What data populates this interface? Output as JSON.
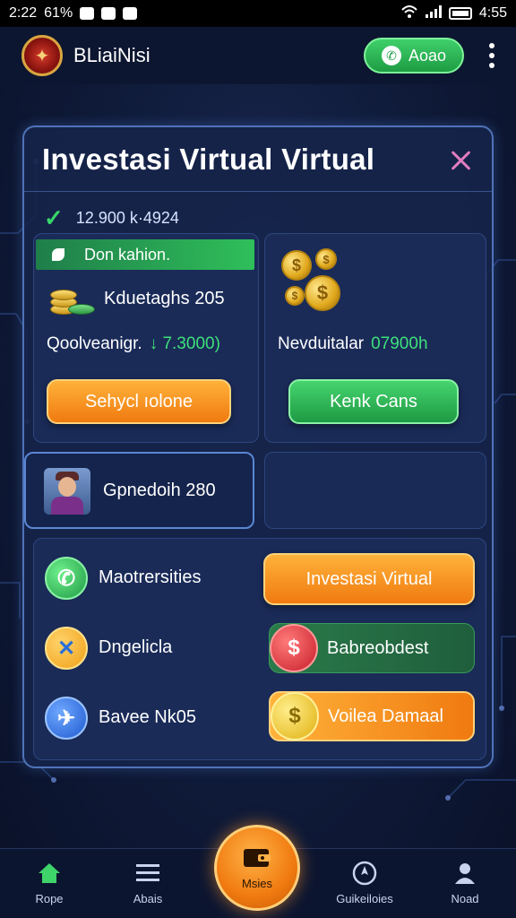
{
  "status_bar": {
    "time": "2:22",
    "percent": "61%",
    "right_time": "4:55"
  },
  "app_bar": {
    "title": "BLiaiNisi",
    "call_label": "Aoao"
  },
  "panel": {
    "title": "Investasi Virtual Virtual",
    "summary": "12.900 k·4924"
  },
  "card_left": {
    "strip_label": "Don kahion.",
    "coins_label": "Kduetaghs 205",
    "balance_label": "Qoolveanigr.",
    "balance_value": "↓ 7.3000)",
    "button_label": "Sehycl ıolone"
  },
  "card_right": {
    "label": "Nevduitalar",
    "value": "07900h",
    "button_label": "Kenk Cans"
  },
  "profile_card": {
    "label": "Gpnedoih 280"
  },
  "list": {
    "items": [
      {
        "label": "Maotrersities"
      },
      {
        "label": "Dngelicla"
      },
      {
        "label": "Bavee Nk05"
      }
    ],
    "actions": [
      {
        "label": "Investasi Virtual"
      },
      {
        "label": "Babreobdest"
      },
      {
        "label": "Voilea Damaal"
      }
    ]
  },
  "bottom_nav": {
    "items": [
      {
        "label": "Rope"
      },
      {
        "label": "Abais"
      },
      {
        "label": "Msies"
      },
      {
        "label": "Guikeiloies"
      },
      {
        "label": "Noad"
      }
    ]
  },
  "colors": {
    "accent_orange": "#f07a10",
    "accent_green": "#2fbf5a",
    "panel_bg": "#16244a"
  }
}
